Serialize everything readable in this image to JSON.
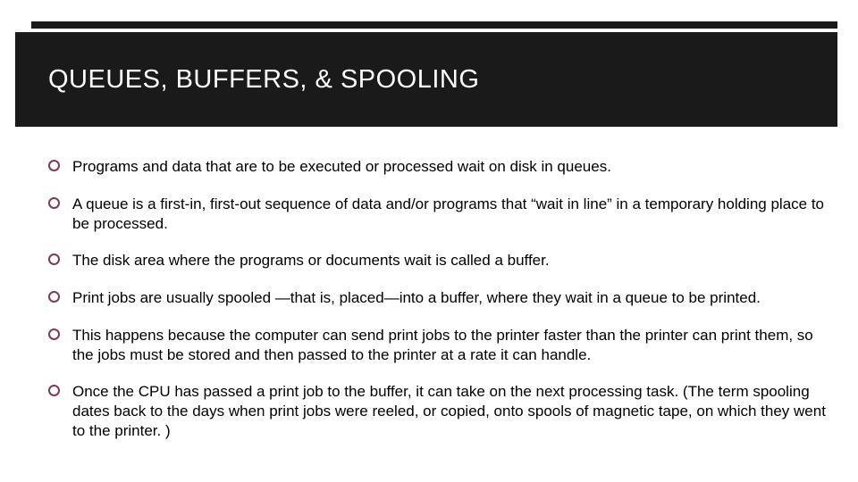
{
  "title": "QUEUES, BUFFERS, & SPOOLING",
  "bullets": [
    "Programs and data that are to be executed or processed wait on disk in  queues.",
    "A queue is a first-in, first-out sequence of data and/or programs that “wait in line” in a temporary holding place to be processed.",
    "The disk area where the programs or documents wait is called a  buffer.",
    "Print jobs are usually  spooled —that is, placed—into a buffer, where they wait in a queue to be printed.",
    "This happens because the computer can send print jobs to the printer faster than the printer can print them, so the jobs must be stored and then passed to the printer at a rate it can handle.",
    "Once the CPU has passed a print job to the buffer, it can take on the next processing task. (The term spooling  dates back to the days when print jobs were reeled, or copied, onto spools of magnetic tape, on which they went to the printer. )"
  ]
}
